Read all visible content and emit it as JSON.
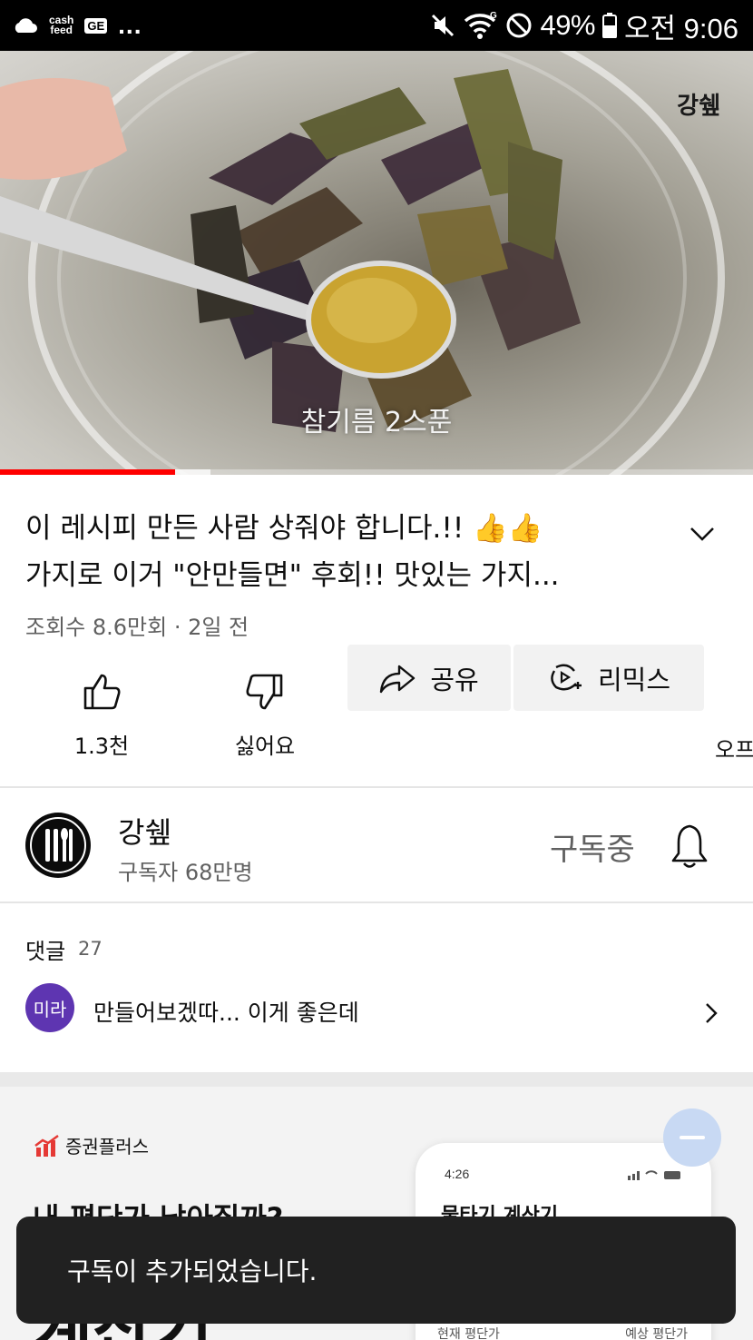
{
  "status_bar": {
    "app_label_top": "cash",
    "app_label_bottom": "feed",
    "ge_label": "GE",
    "more": "...",
    "battery": "49%",
    "time": "오전 9:06"
  },
  "video": {
    "caption": "참기름 2스푼",
    "channel_logo": "강쉪",
    "progress_played": 0.233,
    "progress_buffered": 0.28
  },
  "title": {
    "line1": "이 레시피 만든 사람 상줘야 합니다.!! 👍👍",
    "line2": "가지로 이거 \"안만들면\" 후회!!  맛있는 가지..."
  },
  "meta": "조회수 8.6만회 · 2일 전",
  "actions": {
    "like_label": "1.3천",
    "dislike_label": "싫어요",
    "share_label": "공유",
    "remix_label": "리믹스",
    "offline_label": "오프"
  },
  "channel": {
    "name": "강쉪",
    "subscribers": "구독자 68만명",
    "subscribed_label": "구독중"
  },
  "comments": {
    "title": "댓글",
    "count": "27",
    "avatar_text": "미라",
    "preview": "만들어보겠따... 이게 좋은데"
  },
  "ad": {
    "brand": "증권플러스",
    "headline": "내 평단가 낮아질까?",
    "big_text": "계산기",
    "phone_time": "4:26",
    "phone_title": "물타기 계산기",
    "phone_label_current": "현재 평단가",
    "phone_label_expected": "예상 평단가"
  },
  "toast": "구독이 추가되었습니다.",
  "colors": {
    "accent_red": "#ff0000",
    "text_primary": "#0f0f0f",
    "text_secondary": "#606060",
    "comment_avatar": "#5e35b1"
  }
}
